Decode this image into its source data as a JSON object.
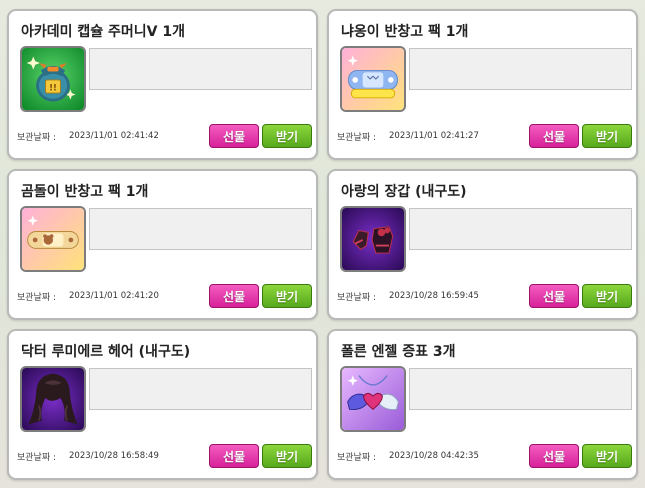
{
  "items": [
    {
      "name": "아카데미 캡슐 주머니V 1개",
      "date_label": "보관날짜 :",
      "date": "2023/11/01 02:41:42",
      "gift_label": "선물",
      "receive_label": "받기",
      "icon": "green-pouch-icon"
    },
    {
      "name": "냐옹이 반창고 팩 1개",
      "date_label": "보관날짜 :",
      "date": "2023/11/01 02:41:27",
      "gift_label": "선물",
      "receive_label": "받기",
      "icon": "cat-bandage-pack-icon"
    },
    {
      "name": "곰돌이 반창고 팩 1개",
      "date_label": "보관날짜 :",
      "date": "2023/11/01 02:41:20",
      "gift_label": "선물",
      "receive_label": "받기",
      "icon": "bear-bandage-pack-icon"
    },
    {
      "name": "아랑의 장갑 (내구도)",
      "date_label": "보관날짜 :",
      "date": "2023/10/28 16:59:45",
      "gift_label": "선물",
      "receive_label": "받기",
      "icon": "gloves-icon"
    },
    {
      "name": "닥터 루미에르 헤어 (내구도)",
      "date_label": "보관날짜 :",
      "date": "2023/10/28 16:58:49",
      "gift_label": "선물",
      "receive_label": "받기",
      "icon": "hair-icon"
    },
    {
      "name": "폴른 엔젤 증표 3개",
      "date_label": "보관날짜 :",
      "date": "2023/10/28 04:42:35",
      "gift_label": "선물",
      "receive_label": "받기",
      "icon": "angel-token-icon"
    }
  ],
  "colors": {
    "gift_button": "#e33aae",
    "receive_button": "#6cbf27",
    "card_border": "#b9b9b9",
    "message_box": "#f0f0f0"
  }
}
